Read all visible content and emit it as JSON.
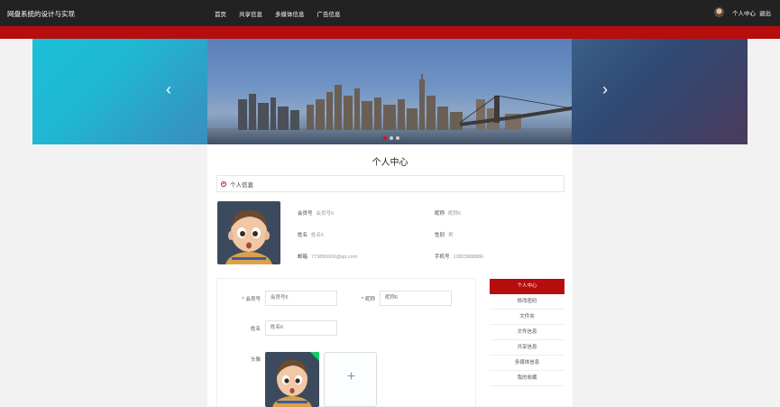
{
  "header": {
    "site_title": "网盘系统的设计与实现",
    "nav": [
      "首页",
      "共享信息",
      "多媒体信息",
      "广告信息"
    ],
    "user_center": "个人中心",
    "logout": "退出"
  },
  "banner": {
    "prev_icon": "chevron-left-icon",
    "next_icon": "chevron-right-icon",
    "slides": 3,
    "active_slide": 1
  },
  "page": {
    "title": "个人中心",
    "section_title": "个人信息"
  },
  "profile": {
    "fields": [
      {
        "label": "会员号",
        "value": "会员号6"
      },
      {
        "label": "昵称",
        "value": "昵称6"
      },
      {
        "label": "姓名",
        "value": "姓名6"
      },
      {
        "label": "性别",
        "value": "男"
      },
      {
        "label": "邮箱",
        "value": "773890006@qq.com"
      },
      {
        "label": "手机号",
        "value": "13823888886"
      }
    ]
  },
  "form": {
    "member_no_label": "会员号",
    "member_no_value": "会员号6",
    "nickname_label": "昵称",
    "nickname_value": "昵称6",
    "name_label": "姓名",
    "name_value": "姓名6",
    "avatar_label": "头像",
    "upload_icon": "plus-icon"
  },
  "side_menu": [
    "个人中心",
    "修改密码",
    "文件夹",
    "文件信息",
    "共享信息",
    "多媒体信息",
    "我的收藏"
  ],
  "colors": {
    "brand_red": "#b60d0d",
    "topbar": "#222222",
    "success": "#13ce66"
  }
}
